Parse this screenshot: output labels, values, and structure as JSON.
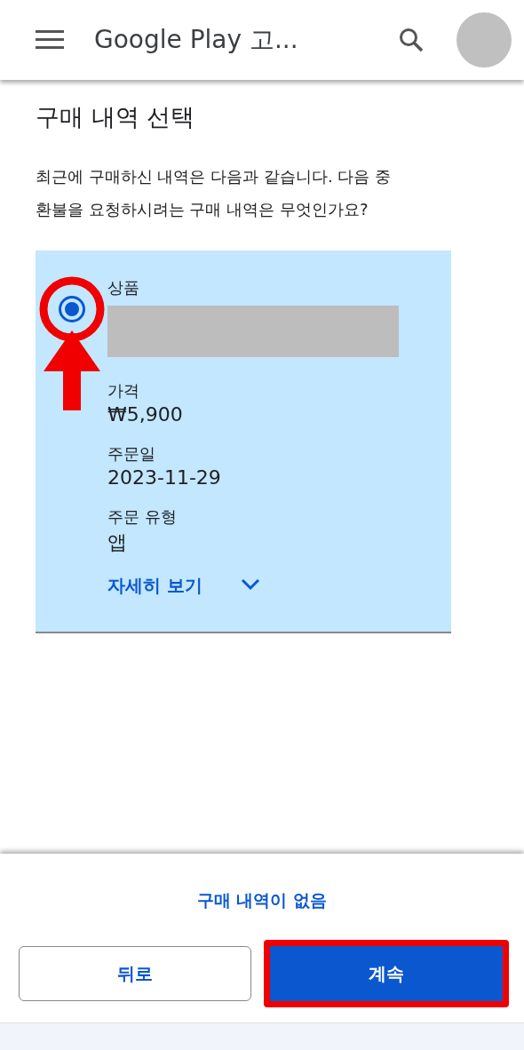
{
  "app_bar": {
    "title": "Google Play 고..."
  },
  "heading": "구매 내역 선택",
  "description": "최근에 구매하신 내역은 다음과 같습니다. 다음 중 환불을 요청하시려는 구매 내역은 무엇인가요?",
  "purchases": [
    {
      "selected": true,
      "annotated": true,
      "product_label": "상품",
      "product_redacted": true,
      "fields": [
        {
          "label": "가격",
          "value": "₩5,900"
        },
        {
          "label": "주문일",
          "value": "2023-11-29"
        },
        {
          "label": "주문 유형",
          "value": "앱"
        }
      ],
      "details_link": "자세히 보기",
      "expanded": false
    }
  ],
  "no_purchase_link": "구매 내역이 없음",
  "buttons": [
    {
      "label": "뒤로",
      "kind": "outlined",
      "annotated": false
    },
    {
      "label": "계속",
      "kind": "filled",
      "annotated": true
    }
  ]
}
